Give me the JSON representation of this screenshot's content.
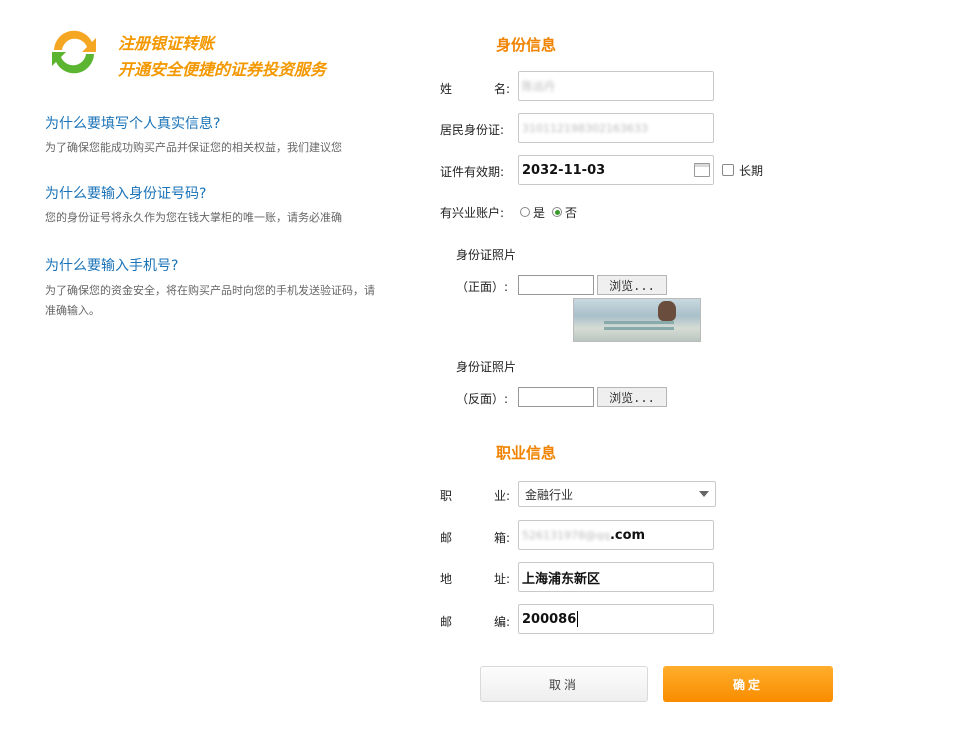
{
  "brand": {
    "slogan_line1": "注册银证转账",
    "slogan_line2": "开通安全便捷的证券投资服务",
    "arrow_orange": "#f5a623",
    "arrow_green": "#5cb531"
  },
  "faq": [
    {
      "question": "为什么要填写个人真实信息?",
      "answer": "为了确保您能成功购买产品并保证您的相关权益，我们建议您"
    },
    {
      "question": "为什么要输入身份证号码?",
      "answer": "您的身份证号将永久作为您在钱大掌柜的唯一账，请务必准确"
    },
    {
      "question": "为什么要输入手机号?",
      "answer": "为了确保您的资金安全，将在购买产品时向您的手机发送验证码，请准确输入。"
    }
  ],
  "identity": {
    "title": "身份信息",
    "name_label_a": "姓",
    "name_label_b": "名:",
    "name_value": "陈远丹",
    "id_label": "居民身份证:",
    "id_value": "310112198302163633",
    "expiry_label": "证件有效期:",
    "expiry_value": "2032-11-03",
    "long_term_label": "长期",
    "xingye_label": "有兴业账户:",
    "yes_label": "是",
    "no_label": "否",
    "selected": "否",
    "photo_label": "身份证照片",
    "front_label": "（正面）:",
    "back_label": "（反面）:",
    "browse_label": "浏览..."
  },
  "occupation": {
    "title": "职业信息",
    "job_label_a": "职",
    "job_label_b": "业:",
    "job_value": "金融行业",
    "email_label_a": "邮",
    "email_label_b": "箱:",
    "email_blurred": "526131978@qq",
    "email_suffix": ".com",
    "address_label_a": "地",
    "address_label_b": "址:",
    "address_value": "上海浦东新区",
    "zip_label_a": "邮",
    "zip_label_b": "编:",
    "zip_value": "200086"
  },
  "actions": {
    "cancel": "取消",
    "confirm": "确定",
    "confirm_color": "#f98c00"
  }
}
